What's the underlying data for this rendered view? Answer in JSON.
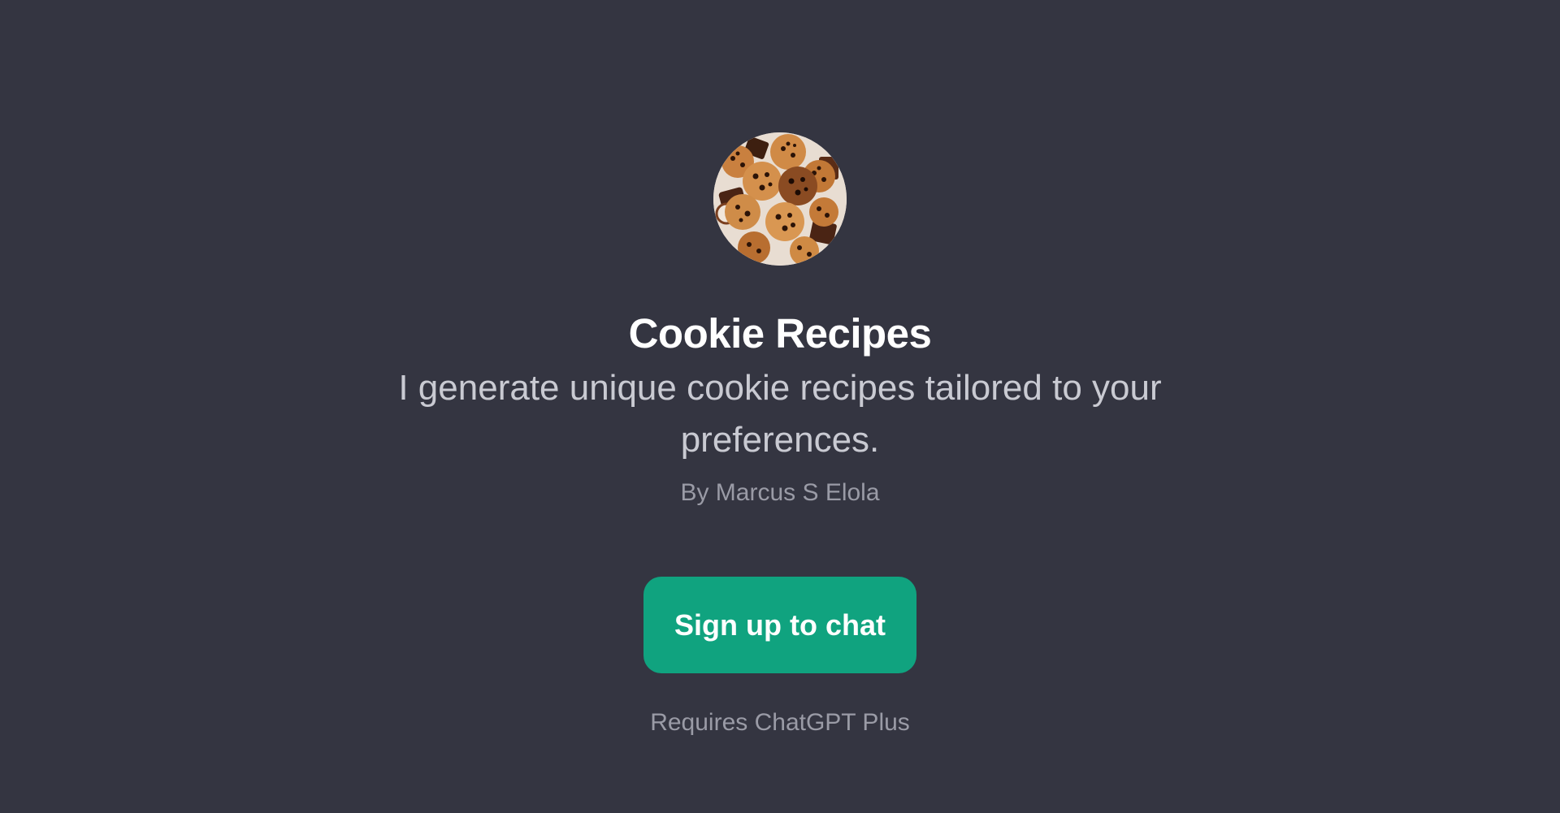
{
  "gpt": {
    "avatar_icon": "cookie-plate-icon",
    "title": "Cookie Recipes",
    "description": "I generate unique cookie recipes tailored to your preferences.",
    "author": "By Marcus S Elola"
  },
  "actions": {
    "signup_label": "Sign up to chat",
    "requirement": "Requires ChatGPT Plus"
  },
  "colors": {
    "background": "#343541",
    "accent": "#10a37f"
  }
}
